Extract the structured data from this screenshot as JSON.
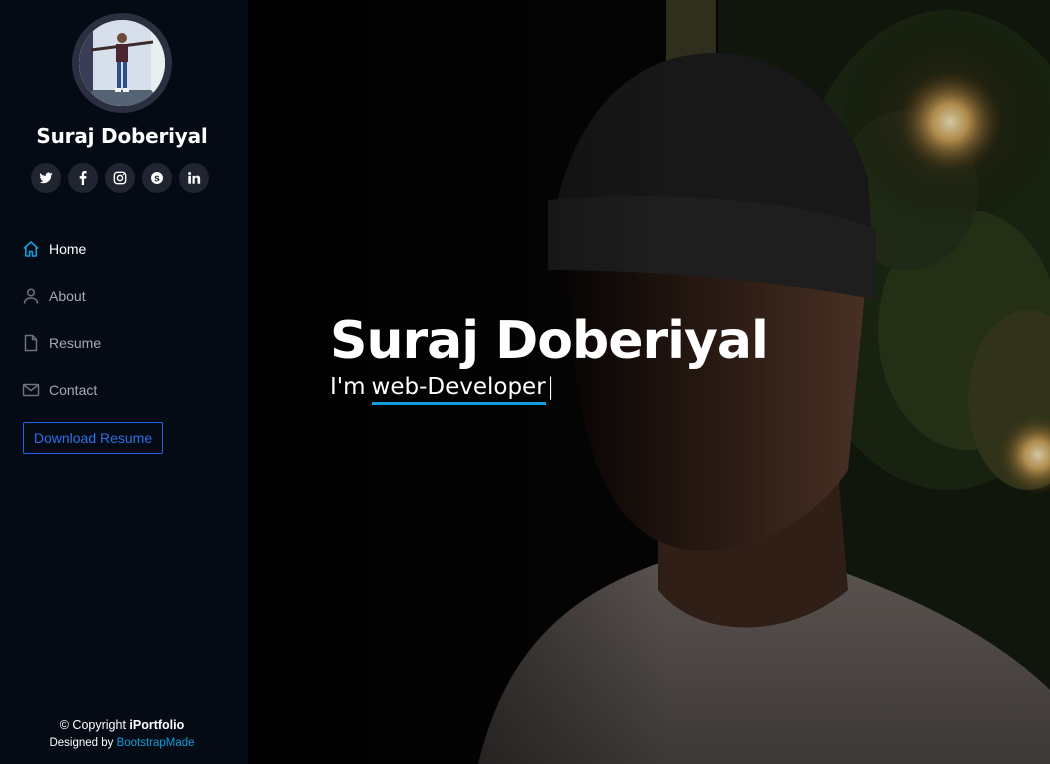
{
  "profile": {
    "name": "Suraj Doberiyal"
  },
  "socials": [
    {
      "icon": "twitter-icon"
    },
    {
      "icon": "facebook-icon"
    },
    {
      "icon": "instagram-icon"
    },
    {
      "icon": "skype-icon"
    },
    {
      "icon": "linkedin-icon"
    }
  ],
  "nav": {
    "items": [
      {
        "label": "Home",
        "icon": "home-icon",
        "active": true
      },
      {
        "label": "About",
        "icon": "person-icon",
        "active": false
      },
      {
        "label": "Resume",
        "icon": "file-icon",
        "active": false
      },
      {
        "label": "Contact",
        "icon": "envelope-icon",
        "active": false
      }
    ]
  },
  "download_button": "Download Resume",
  "footer": {
    "copyright_prefix": "© Copyright ",
    "copyright_brand": "iPortfolio",
    "designed_by": "Designed by ",
    "designer": "BootstrapMade"
  },
  "hero": {
    "title": "Suraj Doberiyal",
    "prefix": "I'm",
    "typed": "web-Developer",
    "cursor": "|"
  },
  "colors": {
    "accent": "#149ddd",
    "sidebar_bg": "#040b14",
    "social_bg": "#212431",
    "button_blue": "#2563eb"
  }
}
